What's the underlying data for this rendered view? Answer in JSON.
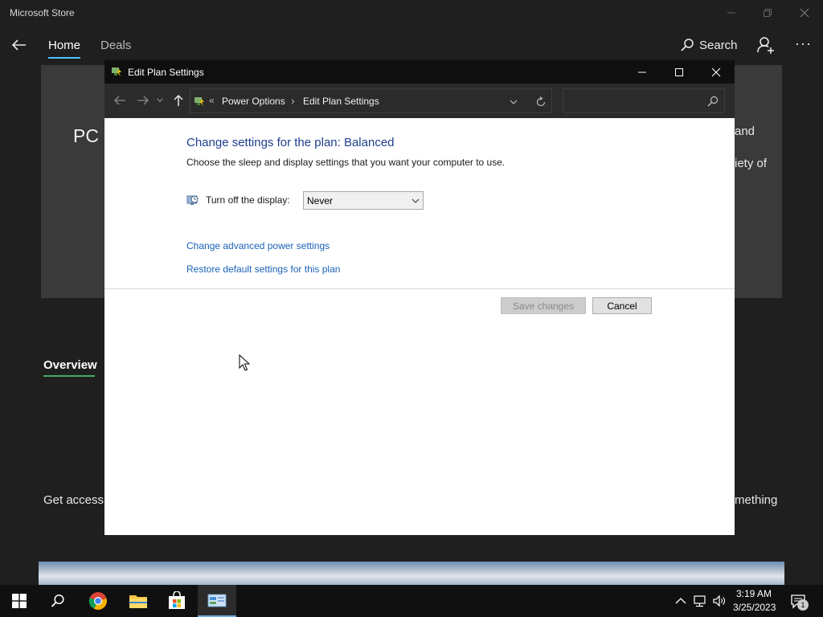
{
  "store": {
    "title": "Microsoft Store",
    "nav": {
      "home": "Home",
      "deals": "Deals"
    },
    "search_label": "Search",
    "more_label": "···",
    "hero": {
      "title": "PC (",
      "right_line1": "and",
      "right_line2": "iety of"
    },
    "overview_tab": "Overview",
    "body_left": "Get access t",
    "body_right": "mething"
  },
  "dialog": {
    "title": "Edit Plan Settings",
    "address": {
      "overflow_chevron": "«",
      "crumbs": [
        "Power Options",
        "Edit Plan Settings"
      ],
      "separator": "›"
    },
    "search_placeholder": "",
    "heading": "Change settings for the plan: Balanced",
    "description": "Choose the sleep and display settings that you want your computer to use.",
    "display_label": "Turn off the display:",
    "display_value": "Never",
    "advanced_link": "Change advanced power settings",
    "restore_link": "Restore default settings for this plan",
    "save_button": "Save changes",
    "cancel_button": "Cancel"
  },
  "taskbar": {
    "time": "3:19 AM",
    "date": "3/25/2023",
    "notification_count": "1",
    "pinned": [
      "start-icon",
      "search-icon",
      "chrome-icon",
      "file-explorer-icon",
      "store-icon",
      "control-panel-icon"
    ]
  },
  "colors": {
    "store_bg": "#1f1f1f",
    "accent_link": "#1a62b8",
    "heading_blue": "#1e3e8c",
    "overview_green": "#3fae65"
  }
}
